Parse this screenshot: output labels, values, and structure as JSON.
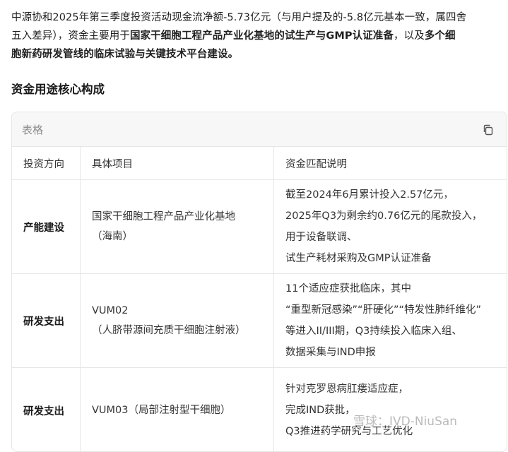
{
  "intro": {
    "line1": "中源协和2025年第三季度投资活动现金流净额-5.73亿元（与用户提及的-5.8亿元基本一致，属四舍",
    "line2_a": "五入差异），资金主要用于",
    "line2_b": "国家干细胞工程产品产业化基地的试生产与GMP认证准备",
    "line2_c": "，以及",
    "line2_d": "多个细",
    "line3": "胞新药研发管线的临床试验与关键技术平台建设。"
  },
  "section_heading": "资金用途核心构成",
  "table": {
    "title": "表格",
    "headers": [
      "投资方向",
      "具体项目",
      "资金匹配说明"
    ],
    "rows": [
      {
        "direction": "产能建设",
        "project": [
          "国家干细胞工程产品产业化基地",
          "（海南）"
        ],
        "description": [
          "截至2024年6月累计投入2.57亿元，",
          "2025年Q3为剩余约0.76亿元的尾款投入，",
          "用于设备联调、",
          "试生产耗材采购及GMP认证准备"
        ]
      },
      {
        "direction": "研发支出",
        "project": [
          "VUM02",
          "（人脐带源间充质干细胞注射液）"
        ],
        "description": [
          "11个适应症获批临床，其中",
          "“重型新冠感染”“肝硬化”“特发性肺纤维化”",
          "等进入II/III期，Q3持续投入临床入组、",
          "数据采集与IND申报"
        ]
      },
      {
        "direction": "研发支出",
        "project": [
          "VUM03（局部注射型干细胞）"
        ],
        "description": [
          "针对克罗恩病肛瘘适应症，",
          "完成IND获批，",
          "Q3推进药学研究与工艺优化"
        ]
      }
    ]
  },
  "watermark": "雪球：IVD-NiuSan"
}
